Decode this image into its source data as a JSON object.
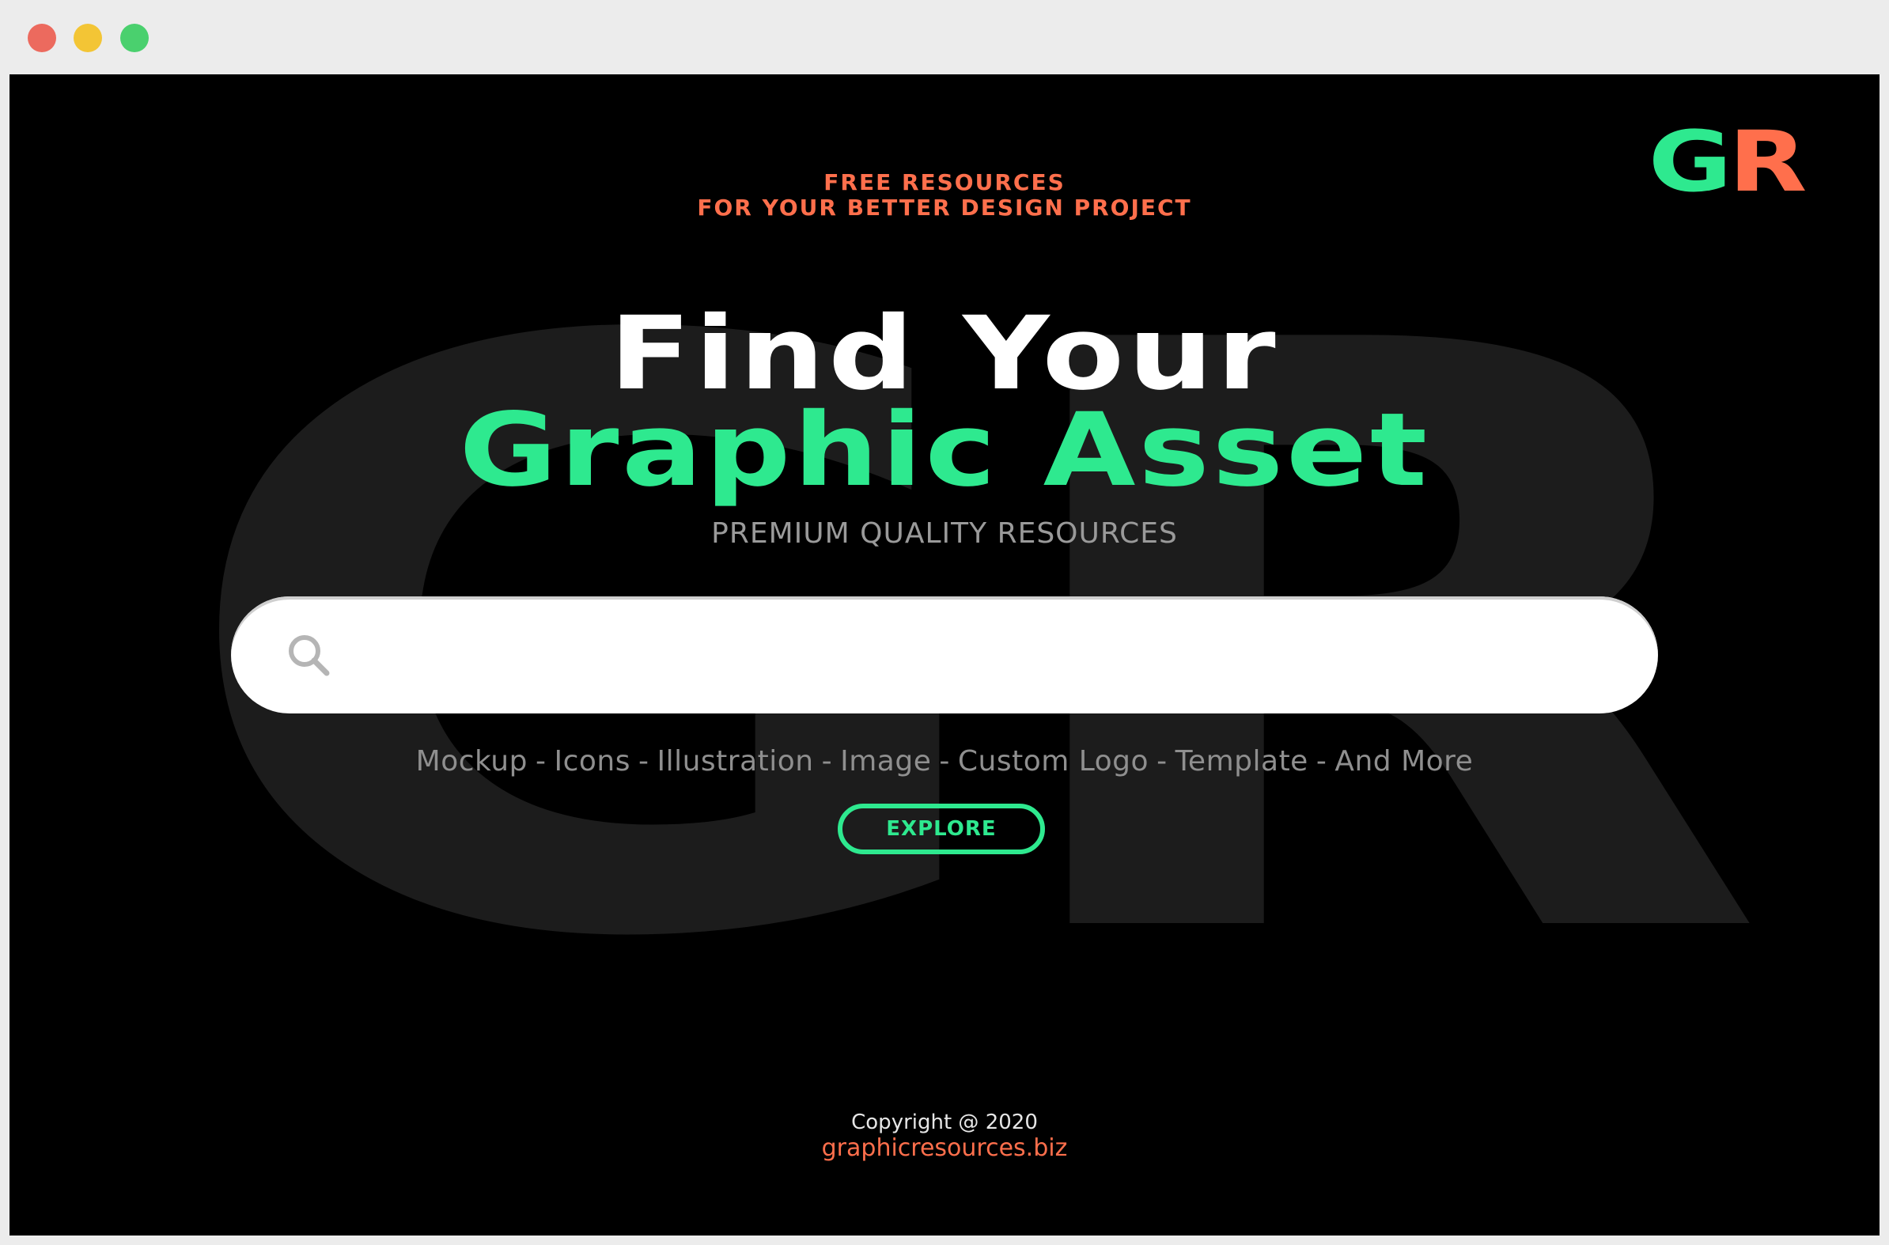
{
  "window": {
    "controls": [
      "close",
      "minimize",
      "maximize"
    ]
  },
  "brand": {
    "logo_g": "G",
    "logo_r": "R",
    "background_mark": "GR",
    "colors": {
      "accent_green": "#2ee98f",
      "accent_orange": "#ff6f4c",
      "background": "#000000"
    }
  },
  "header": {
    "tagline_line1": "FREE RESOURCES",
    "tagline_line2": "FOR YOUR BETTER DESIGN PROJECT"
  },
  "hero": {
    "title_line1": "Find Your",
    "title_line2": "Graphic Asset",
    "subtitle": "PREMIUM QUALITY RESOURCES"
  },
  "search": {
    "icon": "search-icon",
    "value": "",
    "placeholder": ""
  },
  "categories": {
    "items": [
      "Mockup",
      "Icons",
      "Illustration",
      "Image",
      "Custom Logo",
      "Template",
      "And More"
    ],
    "separator": "-"
  },
  "cta": {
    "explore_label": "EXPLORE"
  },
  "footer": {
    "copyright": "Copyright @ 2020",
    "site": "graphicresources.biz"
  }
}
